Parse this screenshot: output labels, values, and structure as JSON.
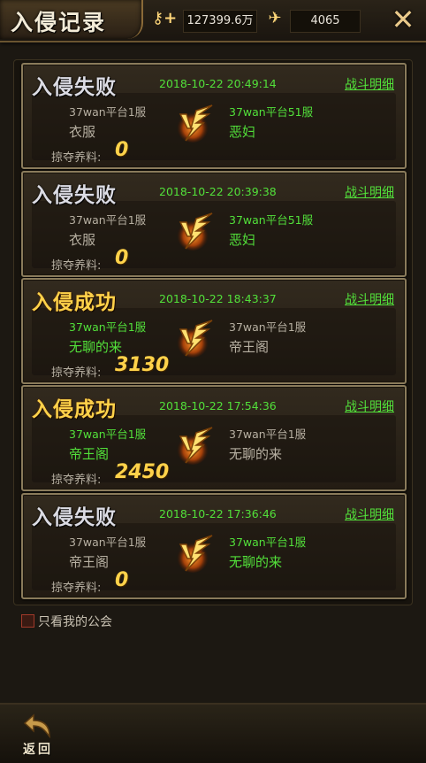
{
  "header": {
    "title": "入侵记录",
    "gold": "127399.6万",
    "diamonds": "4065",
    "gold_icon": "key-plus-icon",
    "diamond_icon": "wing-icon",
    "close_icon": "close-icon"
  },
  "records": [
    {
      "result": "入侵失败",
      "time": "2018-10-22  20:49:14",
      "detail": "战斗明细",
      "left_server": "37wan平台1服",
      "left_name": "衣服",
      "right_server": "37wan平台51服",
      "right_name": "恶妇",
      "loot_label": "掠夺养料:",
      "loot": "0"
    },
    {
      "result": "入侵失败",
      "time": "2018-10-22  20:39:38",
      "detail": "战斗明细",
      "left_server": "37wan平台1服",
      "left_name": "衣服",
      "right_server": "37wan平台51服",
      "right_name": "恶妇",
      "loot_label": "掠夺养料:",
      "loot": "0"
    },
    {
      "result": "入侵成功",
      "time": "2018-10-22  18:43:37",
      "detail": "战斗明细",
      "left_server": "37wan平台1服",
      "left_name": "无聊的来",
      "right_server": "37wan平台1服",
      "right_name": "帝王阁",
      "loot_label": "掠夺养料:",
      "loot": "3130"
    },
    {
      "result": "入侵成功",
      "time": "2018-10-22  17:54:36",
      "detail": "战斗明细",
      "left_server": "37wan平台1服",
      "left_name": "帝王阁",
      "right_server": "37wan平台1服",
      "right_name": "无聊的来",
      "loot_label": "掠夺养料:",
      "loot": "2450"
    },
    {
      "result": "入侵失败",
      "time": "2018-10-22  17:36:46",
      "detail": "战斗明细",
      "left_server": "37wan平台1服",
      "left_name": "帝王阁",
      "right_server": "37wan平台1服",
      "right_name": "无聊的来",
      "loot_label": "掠夺养料:",
      "loot": "0"
    }
  ],
  "filter": {
    "label": "只看我的公会",
    "checked": false
  },
  "footer": {
    "back_label": "返回"
  },
  "colors": {
    "success": "#ffd24a",
    "fail": "#dcdce4",
    "highlight": "#52e03a",
    "text": "#b7b0a2"
  }
}
